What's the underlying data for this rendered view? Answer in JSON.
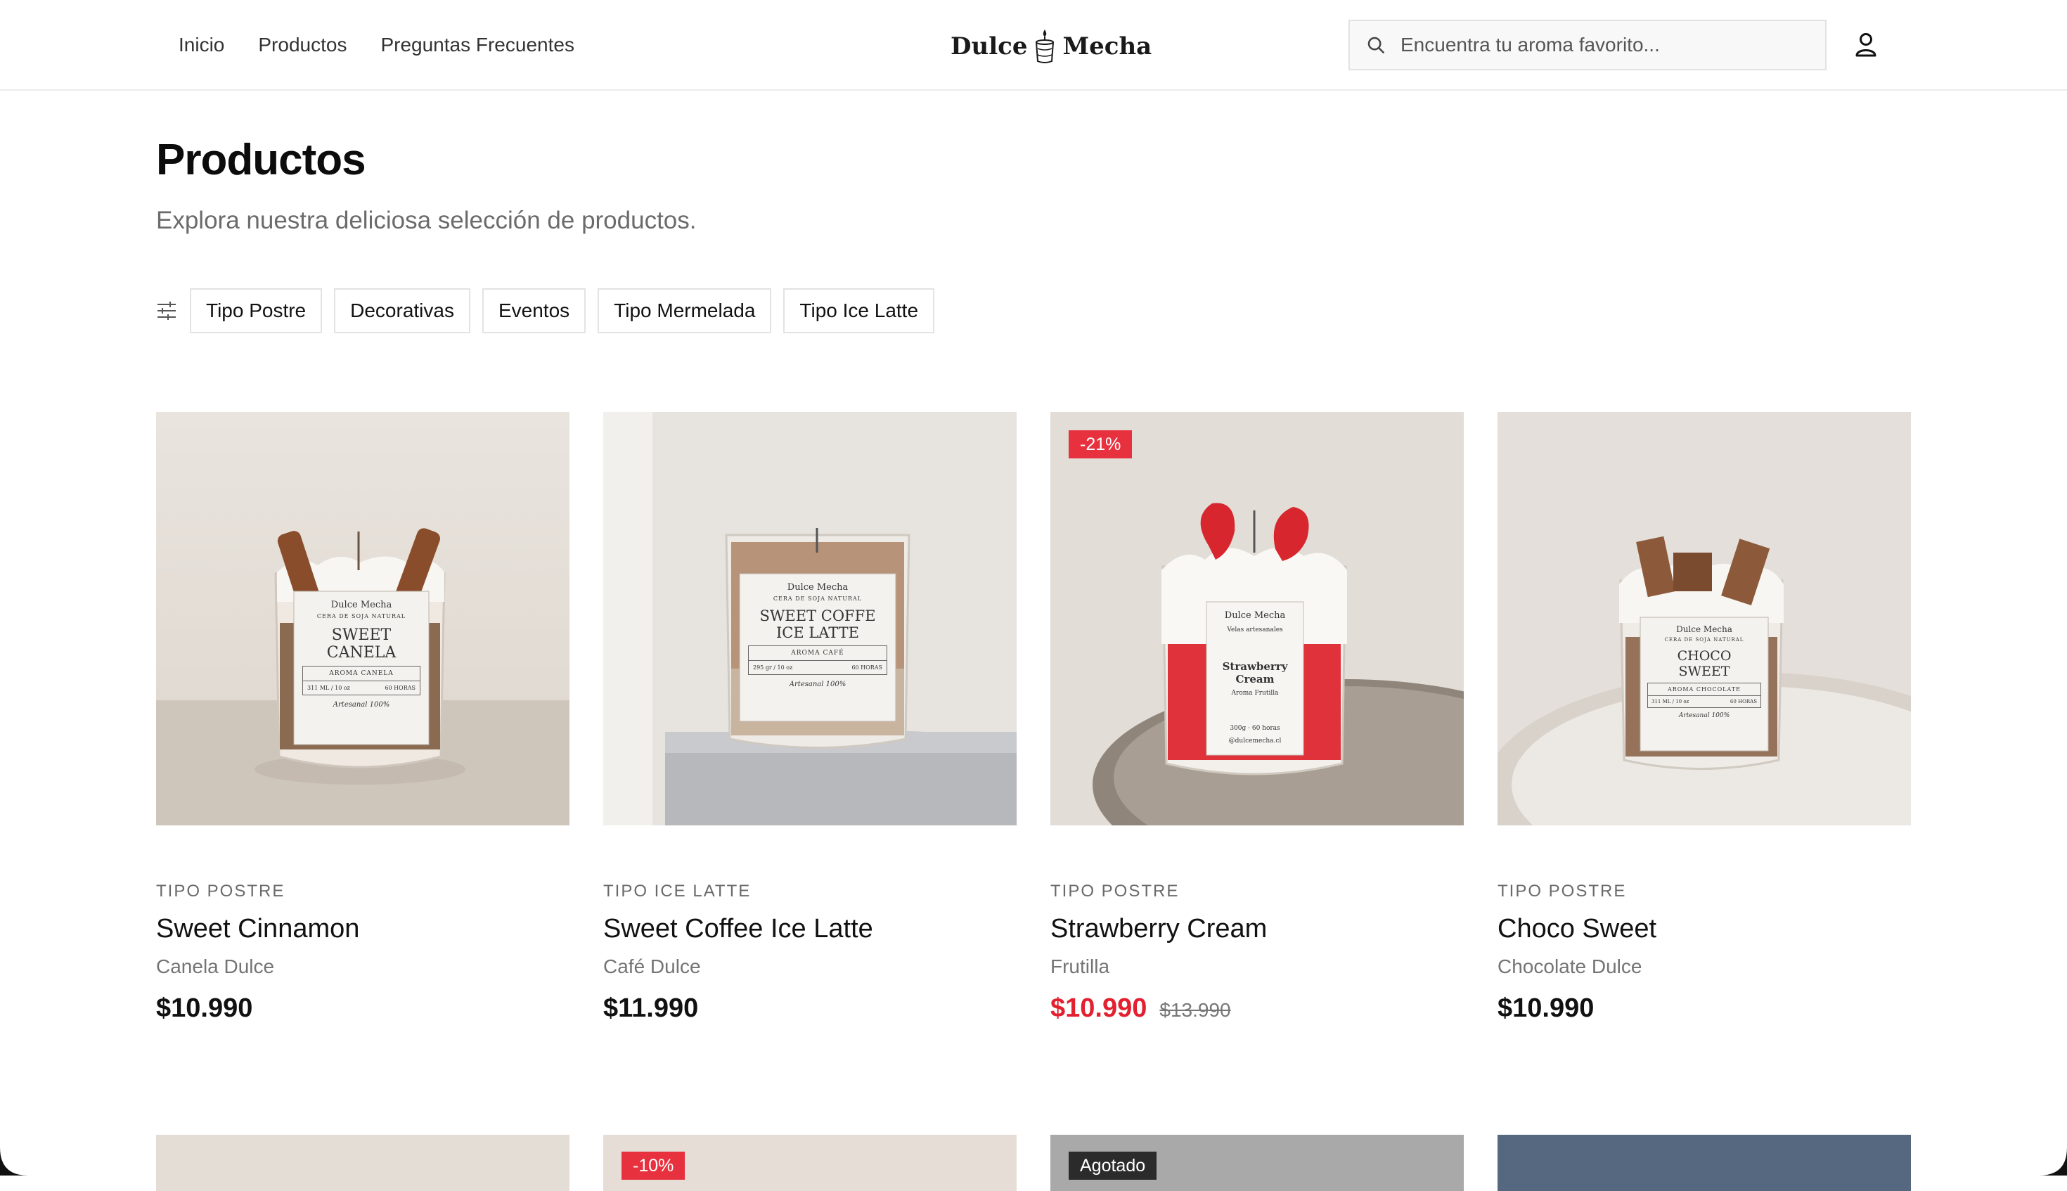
{
  "nav": {
    "items": [
      {
        "label": "Inicio"
      },
      {
        "label": "Productos"
      },
      {
        "label": "Preguntas Frecuentes"
      }
    ]
  },
  "brand": {
    "name_left": "Dulce",
    "name_right": "Mecha"
  },
  "search": {
    "placeholder": "Encuentra tu aroma favorito...",
    "icon": "search-icon"
  },
  "account": {
    "icon": "user-icon"
  },
  "page": {
    "title": "Productos",
    "subtitle": "Explora nuestra deliciosa selección de productos."
  },
  "filters": {
    "icon": "sliders-icon",
    "chips": [
      {
        "label": "Tipo Postre"
      },
      {
        "label": "Decorativas"
      },
      {
        "label": "Eventos"
      },
      {
        "label": "Tipo Mermelada"
      },
      {
        "label": "Tipo Ice Latte"
      }
    ]
  },
  "products": [
    {
      "category": "TIPO POSTRE",
      "name": "Sweet Cinnamon",
      "aroma": "Canela Dulce",
      "price": "$10.990",
      "old_price": "",
      "badge": "",
      "label": {
        "brand": "Dulce Mecha",
        "sub": "CERA DE SOJA NATURAL",
        "title1": "SWEET",
        "title2": "CANELA",
        "aroma": "AROMA CANELA",
        "l": "311 ML / 10 oz",
        "r": "60 HORAS",
        "sig": "Artesanal 100%"
      }
    },
    {
      "category": "TIPO ICE LATTE",
      "name": "Sweet Coffee Ice Latte",
      "aroma": "Café Dulce",
      "price": "$11.990",
      "old_price": "",
      "badge": "",
      "label": {
        "brand": "Dulce Mecha",
        "sub": "CERA DE SOJA NATURAL",
        "title1": "SWEET COFFE",
        "title2": "ICE LATTE",
        "aroma": "AROMA CAFÉ",
        "l": "295 gr / 10 oz",
        "r": "60 HORAS",
        "sig": "Artesanal 100%"
      }
    },
    {
      "category": "TIPO POSTRE",
      "name": "Strawberry Cream",
      "aroma": "Frutilla",
      "price": "$10.990",
      "old_price": "$13.990",
      "badge": "-21%",
      "label": {
        "brand": "Dulce Mecha",
        "sub": "Velas artesanales",
        "title1": "Strawberry Cream",
        "title2": "Aroma Frutilla",
        "aroma": "",
        "l": "300g · 60 horas",
        "r": "@dulcemecha.cl",
        "sig": ""
      }
    },
    {
      "category": "TIPO POSTRE",
      "name": "Choco Sweet",
      "aroma": "Chocolate Dulce",
      "price": "$10.990",
      "old_price": "",
      "badge": "",
      "label": {
        "brand": "Dulce Mecha",
        "sub": "CERA DE SOJA NATURAL",
        "title1": "CHOCO",
        "title2": "SWEET",
        "aroma": "AROMA CHOCOLATE",
        "l": "311 ML / 10 oz",
        "r": "60 HORAS",
        "sig": "Artesanal 100%"
      }
    }
  ],
  "next_row": [
    {
      "badge": ""
    },
    {
      "badge": "-10%"
    },
    {
      "badge": "Agotado"
    },
    {
      "badge": ""
    }
  ],
  "colors": {
    "sale": "#e3202f",
    "badge": "#e8313f",
    "sold_out": "#2b2b2b"
  }
}
